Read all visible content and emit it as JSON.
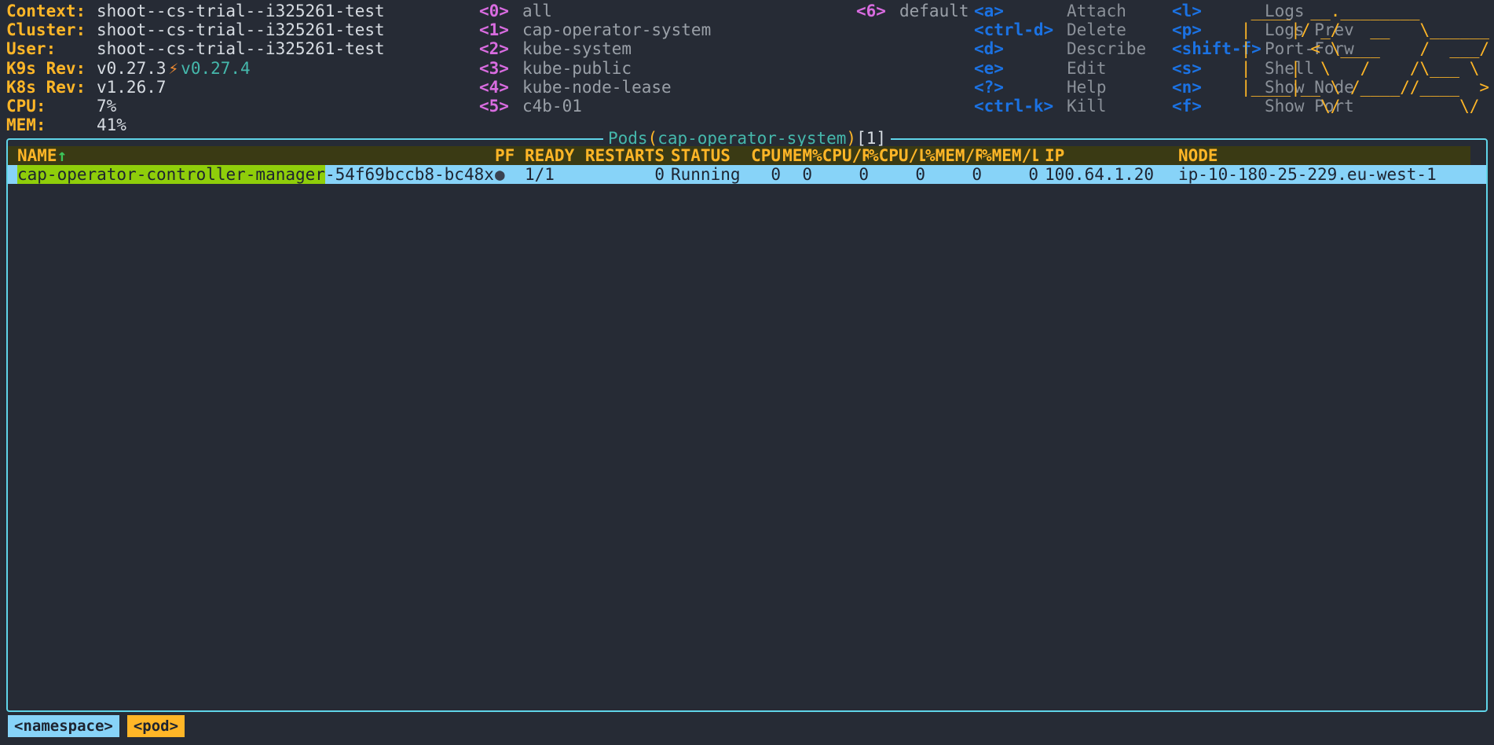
{
  "header": {
    "info": [
      {
        "key": "Context:",
        "value": "shoot--cs-trial--i325261-test"
      },
      {
        "key": "Cluster:",
        "value": "shoot--cs-trial--i325261-test"
      },
      {
        "key": "User:",
        "value": "shoot--cs-trial--i325261-test"
      },
      {
        "key": "K9s Rev:",
        "value": "v0.27.3",
        "bolt": "⚡",
        "new_version": "v0.27.4"
      },
      {
        "key": "K8s Rev:",
        "value": "v1.26.7"
      },
      {
        "key": "CPU:",
        "value": "7%"
      },
      {
        "key": "MEM:",
        "value": "41%"
      }
    ],
    "namespaces": [
      {
        "key": "<0>",
        "label": "all"
      },
      {
        "key": "<1>",
        "label": "cap-operator-system"
      },
      {
        "key": "<2>",
        "label": "kube-system"
      },
      {
        "key": "<3>",
        "label": "kube-public"
      },
      {
        "key": "<4>",
        "label": "kube-node-lease"
      },
      {
        "key": "<5>",
        "label": "c4b-01"
      }
    ],
    "namespaces2": [
      {
        "key": "<6>",
        "label": "default"
      }
    ],
    "shortcuts_col1": [
      {
        "key": "<a>",
        "label": "Attach"
      },
      {
        "key": "<ctrl-d>",
        "label": "Delete"
      },
      {
        "key": "<d>",
        "label": "Describe"
      },
      {
        "key": "<e>",
        "label": "Edit"
      },
      {
        "key": "<?>",
        "label": "Help"
      },
      {
        "key": "<ctrl-k>",
        "label": "Kill"
      }
    ],
    "shortcuts_col2": [
      {
        "key": "<l>",
        "label": "Logs"
      },
      {
        "key": "<p>",
        "label": "Logs Prev"
      },
      {
        "key": "<shift-f>",
        "label": "Port-Forw"
      },
      {
        "key": "<s>",
        "label": "Shell"
      },
      {
        "key": "<n>",
        "label": "Show Node"
      },
      {
        "key": "<f>",
        "label": "Show Port"
      }
    ],
    "logo_lines": [
      " ____  __.________",
      "|    |/ _/   __   \\______",
      "|      < \\____    /  ___/",
      "|    |  \\   /    /\\___ \\",
      "|____|__ \\ /____//____  >",
      "        \\/            \\/"
    ]
  },
  "panel": {
    "title_prefix": "Pods",
    "title_open": "(",
    "title_namespace": "cap-operator-system",
    "title_close": ")",
    "title_count": "[1]"
  },
  "table": {
    "columns": [
      "NAME",
      "PF",
      "READY",
      "RESTARTS",
      "STATUS",
      "CPU",
      "MEM",
      "%CPU/R",
      "%CPU/L",
      "%MEM/R",
      "%MEM/L",
      "IP",
      "NODE"
    ],
    "sort_indicator": "↑",
    "rows": [
      {
        "name_match": "cap-operator-controller-manager",
        "name_rest": "-54f69bccb8-bc48x",
        "pf": "●",
        "ready": "1/1",
        "restarts": "0",
        "status": "Running",
        "cpu": "0",
        "mem": "0",
        "cpu_r": "0",
        "cpu_l": "0",
        "mem_r": "0",
        "mem_l": "0",
        "ip": "100.64.1.20",
        "node": "ip-10-180-25-229.eu-west-1"
      }
    ]
  },
  "crumbs": [
    {
      "label": "<namespace>",
      "kind": "ns"
    },
    {
      "label": "<pod>",
      "kind": "pod"
    }
  ],
  "colors": {
    "background": "#262b35",
    "border": "#5fd4e8",
    "accent_yellow": "#ffb627",
    "accent_teal": "#45b8ac",
    "accent_blue": "#1b72e3",
    "accent_magenta": "#d96ce0",
    "selection": "#87d3f8",
    "search_match": "#8fce0a"
  }
}
